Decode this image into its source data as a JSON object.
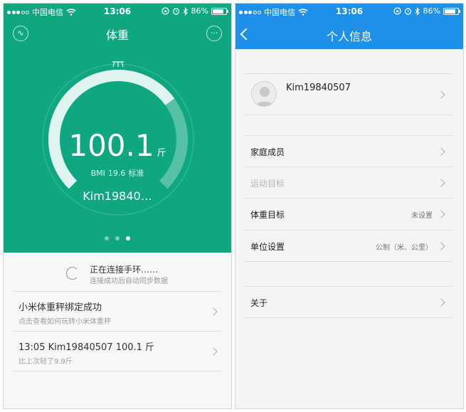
{
  "left": {
    "status": {
      "carrier": "中国电信",
      "time": "13:06",
      "battery": "86%",
      "battery_level": 0.86,
      "icons": [
        "signal-dots",
        "wifi-icon",
        "alarm-icon",
        "bluetooth-icon",
        "battery-icon"
      ]
    },
    "header": {
      "title": "体重",
      "left_icon": "wave-icon",
      "left_glyph": "∿",
      "right_icon": "more-icon",
      "right_glyph": "···"
    },
    "gauge": {
      "weight": "100.1",
      "unit": "斤",
      "bmi_label": "BMI",
      "bmi_value": "19.6",
      "bmi_status": "标准",
      "user": "Kim19840…",
      "level": 0.7,
      "icon": "scale-icon"
    },
    "pager": {
      "count": 3,
      "active": 2
    },
    "connect": {
      "title": "正在连接手环……",
      "subtitle": "连接成功后自动同步数据"
    },
    "cards": [
      {
        "title": "小米体重秤绑定成功",
        "subtitle": "点击查看如何玩转小米体重秤"
      },
      {
        "title": "13:05 Kim19840507 100.1 斤",
        "subtitle": "比上次轻了9.9斤"
      }
    ],
    "colors": {
      "hero": "#0fa782",
      "text": "#333333",
      "muted": "#a0a0a0"
    }
  },
  "right": {
    "status": {
      "carrier": "中国电信",
      "time": "13:06",
      "battery": "86%",
      "battery_level": 0.86
    },
    "nav": {
      "title": "个人信息",
      "back_icon": "back-chevron-icon"
    },
    "profile": {
      "name": "Kim19840507",
      "avatar_icon": "avatar-placeholder-icon"
    },
    "rows": [
      {
        "label": "家庭成员",
        "value": ""
      },
      {
        "label": "运动目标",
        "value": "",
        "disabled": true
      },
      {
        "label": "体重目标",
        "value": "未设置"
      },
      {
        "label": "单位设置",
        "value": "公制（米、公里）"
      }
    ],
    "about": {
      "label": "关于"
    },
    "colors": {
      "nav": "#1e90e8",
      "bg": "#f4f4f4"
    }
  }
}
